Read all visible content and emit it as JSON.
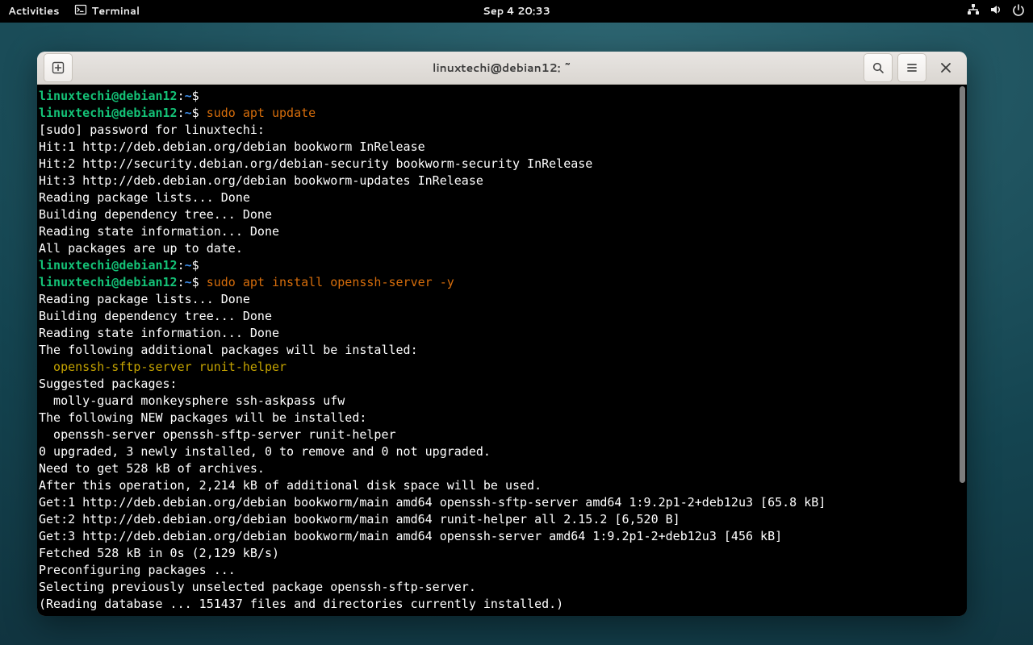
{
  "topbar": {
    "activities": "Activities",
    "app_label": "Terminal",
    "clock": "Sep 4  20:33"
  },
  "window": {
    "title": "linuxtechi@debian12: ~"
  },
  "prompt": {
    "user_host": "linuxtechi@debian12",
    "colon": ":",
    "path": "~",
    "dollar": "$"
  },
  "cmds": {
    "c1": "sudo apt update",
    "c2": "sudo apt install openssh-server -y"
  },
  "hl": {
    "pkgs": "  openssh-sftp-server runit-helper"
  },
  "out": {
    "l01": "[sudo] password for linuxtechi: ",
    "l02": "Hit:1 http://deb.debian.org/debian bookworm InRelease",
    "l03": "Hit:2 http://security.debian.org/debian-security bookworm-security InRelease",
    "l04": "Hit:3 http://deb.debian.org/debian bookworm-updates InRelease",
    "l05": "Reading package lists... Done",
    "l06": "Building dependency tree... Done",
    "l07": "Reading state information... Done",
    "l08": "All packages are up to date.",
    "l09": "Reading package lists... Done",
    "l10": "Building dependency tree... Done",
    "l11": "Reading state information... Done",
    "l12": "The following additional packages will be installed:",
    "l13": "Suggested packages:",
    "l14": "  molly-guard monkeysphere ssh-askpass ufw",
    "l15": "The following NEW packages will be installed:",
    "l16": "  openssh-server openssh-sftp-server runit-helper",
    "l17": "0 upgraded, 3 newly installed, 0 to remove and 0 not upgraded.",
    "l18": "Need to get 528 kB of archives.",
    "l19": "After this operation, 2,214 kB of additional disk space will be used.",
    "l20": "Get:1 http://deb.debian.org/debian bookworm/main amd64 openssh-sftp-server amd64 1:9.2p1-2+deb12u3 [65.8 kB]",
    "l21": "Get:2 http://deb.debian.org/debian bookworm/main amd64 runit-helper all 2.15.2 [6,520 B]",
    "l22": "Get:3 http://deb.debian.org/debian bookworm/main amd64 openssh-server amd64 1:9.2p1-2+deb12u3 [456 kB]",
    "l23": "Fetched 528 kB in 0s (2,129 kB/s)",
    "l24": "Preconfiguring packages ...",
    "l25": "Selecting previously unselected package openssh-sftp-server.",
    "l26": "(Reading database ... 151437 files and directories currently installed.)"
  }
}
